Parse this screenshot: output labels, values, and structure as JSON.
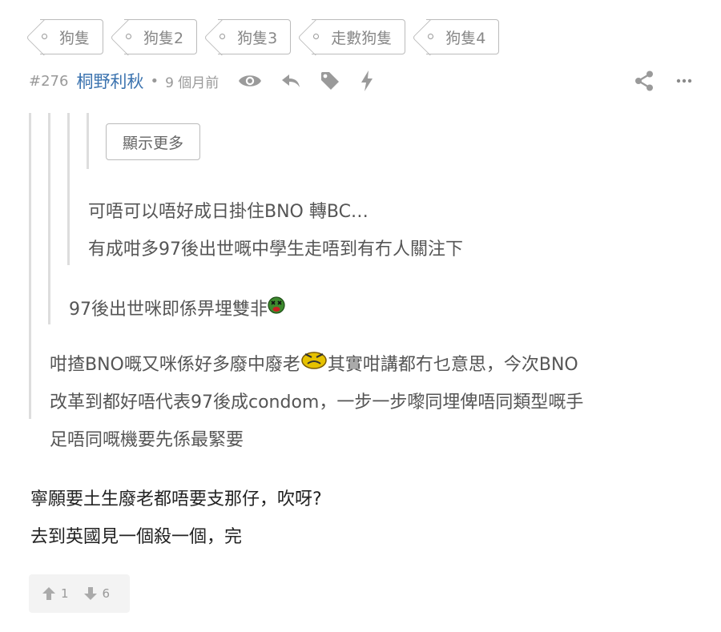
{
  "tags": [
    "狗隻",
    "狗隻2",
    "狗隻3",
    "走數狗隻",
    "狗隻4"
  ],
  "post": {
    "number": "#276",
    "author": "桐野利秋",
    "separator": "•",
    "time": "9 個月前"
  },
  "icons": {
    "view": "eye-icon",
    "reply": "reply-icon",
    "tag": "tag-icon",
    "boost": "lightning-icon",
    "share": "share-icon",
    "more": "more-icon"
  },
  "quotes": {
    "show_more_label": "顯示更多",
    "level3_lines": [
      "可唔可以唔好成日掛住BNO 轉BC…",
      "有成咁多97後出世嘅中學生走唔到有冇人關注下"
    ],
    "level2_line": "97後出世咪即係畀埋雙非",
    "level1_lines": [
      "咁揸BNO嘅又咪係好多廢中廢老",
      "其實咁講都冇乜意思，今次BNO",
      "改革到都好唔代表97後成condom，一步一步嚟同埋俾唔同類型嘅手",
      "足唔同嘅機要先係最緊要"
    ]
  },
  "reply": {
    "lines": [
      "寧願要土生廢老都唔要支那仔，吹呀?",
      "去到英國見一個殺一個，完"
    ]
  },
  "votes": {
    "up": "1",
    "down": "6"
  },
  "colors": {
    "author": "#3b73af",
    "muted": "#999999",
    "quote_bar": "#dddddd"
  }
}
